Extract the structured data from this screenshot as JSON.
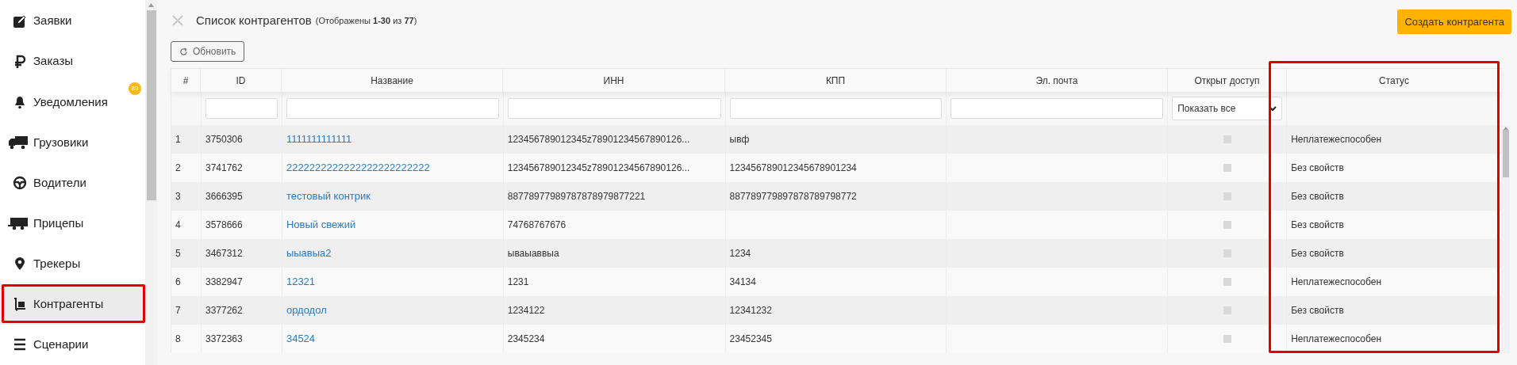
{
  "sidebar": {
    "items": [
      {
        "label": "Заявки",
        "selected": false
      },
      {
        "label": "Заказы",
        "selected": false
      },
      {
        "label": "Уведомления",
        "selected": false,
        "badge": "83"
      },
      {
        "label": "Грузовики",
        "selected": false
      },
      {
        "label": "Водители",
        "selected": false
      },
      {
        "label": "Прицепы",
        "selected": false
      },
      {
        "label": "Трекеры",
        "selected": false
      },
      {
        "label": "Контрагенты",
        "selected": true,
        "highlighted": true
      },
      {
        "label": "Сценарии",
        "selected": false
      }
    ]
  },
  "header": {
    "title": "Список контрагентов",
    "subtitle": "(Отображены **1-30** из **77**)",
    "create_button": "Создать контрагента",
    "refresh_button": "Обновить"
  },
  "table": {
    "columns": [
      {
        "label": "#",
        "kind": "plain"
      },
      {
        "label": "ID",
        "kind": "text"
      },
      {
        "label": "Название",
        "kind": "text"
      },
      {
        "label": "ИНН",
        "kind": "text"
      },
      {
        "label": "КПП",
        "kind": "text"
      },
      {
        "label": "Эл. почта",
        "kind": "text"
      },
      {
        "label": "Открыт доступ",
        "kind": "select",
        "filter_value": "Показать все"
      },
      {
        "label": "Статус",
        "kind": "plain",
        "highlighted": true
      }
    ],
    "rows": [
      {
        "num": "1",
        "id": "3750306",
        "name": "1111111111111",
        "inn": "123456789012345z78901234567890126...",
        "kpp": "ывф",
        "email": "",
        "open_access": false,
        "status": "Неплатежеспособен"
      },
      {
        "num": "2",
        "id": "3741762",
        "name": "2222222222222222222222222",
        "inn": "123456789012345z78901234567890126...",
        "kpp": "123456789012345678901234",
        "email": "",
        "open_access": false,
        "status": "Без свойств"
      },
      {
        "num": "3",
        "id": "3666395",
        "name": "тестовый контрик",
        "inn": "88778977989787878979877221",
        "kpp": "887789779897878789798772",
        "email": "",
        "open_access": false,
        "status": "Без свойств"
      },
      {
        "num": "4",
        "id": "3578666",
        "name": "Новый свежий",
        "inn": "74768767676",
        "kpp": "",
        "email": "",
        "open_access": false,
        "status": "Без свойств"
      },
      {
        "num": "5",
        "id": "3467312",
        "name": "ыыавыа2",
        "inn": "ываыаввыа",
        "kpp": "1234",
        "email": "",
        "open_access": false,
        "status": "Без свойств"
      },
      {
        "num": "6",
        "id": "3382947",
        "name": "12321",
        "inn": "1231",
        "kpp": "34134",
        "email": "",
        "open_access": false,
        "status": "Неплатежеспособен"
      },
      {
        "num": "7",
        "id": "3377262",
        "name": "ордодол",
        "inn": "1234122",
        "kpp": "12341232",
        "email": "",
        "open_access": false,
        "status": "Без свойств"
      },
      {
        "num": "8",
        "id": "3372363",
        "name": "34524",
        "inn": "2345234",
        "kpp": "23452345",
        "email": "",
        "open_access": false,
        "status": "Неплатежеспособен"
      }
    ]
  }
}
